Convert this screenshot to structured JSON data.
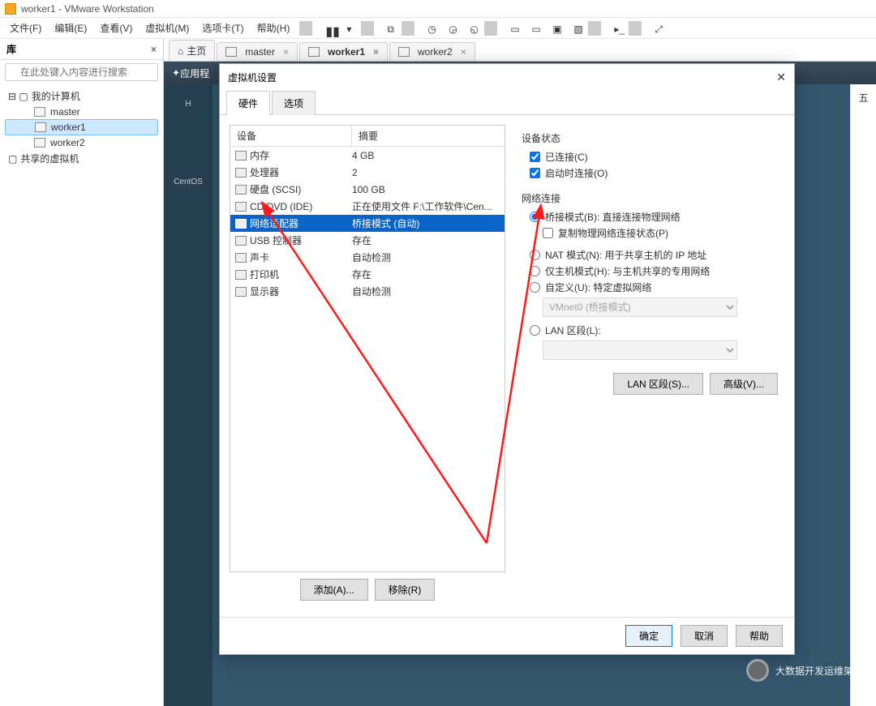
{
  "title": "worker1 - VMware Workstation",
  "menus": [
    "文件(F)",
    "编辑(E)",
    "查看(V)",
    "虚拟机(M)",
    "选项卡(T)",
    "帮助(H)"
  ],
  "library": {
    "title": "库",
    "search_placeholder": "在此处键入内容进行搜索",
    "root": "我的计算机",
    "items": [
      "master",
      "worker1",
      "worker2"
    ],
    "selected": "worker1",
    "shared": "共享的虚拟机"
  },
  "tabs": {
    "home": "主页",
    "items": [
      "master",
      "worker1",
      "worker2"
    ],
    "active": "worker1",
    "app_strip": "应用程",
    "right_label": "五"
  },
  "desktop_side_label": "CentOS",
  "dialog": {
    "title": "虚拟机设置",
    "tabs": [
      "硬件",
      "选项"
    ],
    "headers": {
      "device": "设备",
      "summary": "摘要"
    },
    "devices": [
      {
        "name": "内存",
        "summary": "4 GB"
      },
      {
        "name": "处理器",
        "summary": "2"
      },
      {
        "name": "硬盘 (SCSI)",
        "summary": "100 GB"
      },
      {
        "name": "CD/DVD (IDE)",
        "summary": "正在使用文件 F:\\工作软件\\Cen..."
      },
      {
        "name": "网络适配器",
        "summary": "桥接模式 (自动)"
      },
      {
        "name": "USB 控制器",
        "summary": "存在"
      },
      {
        "name": "声卡",
        "summary": "自动检测"
      },
      {
        "name": "打印机",
        "summary": "存在"
      },
      {
        "name": "显示器",
        "summary": "自动检测"
      }
    ],
    "selected_device": "网络适配器",
    "buttons": {
      "add": "添加(A)...",
      "remove": "移除(R)"
    },
    "status": {
      "title": "设备状态",
      "connected": "已连接(C)",
      "connect_at_power_on": "启动时连接(O)"
    },
    "net": {
      "title": "网络连接",
      "bridged": "桥接模式(B): 直接连接物理网络",
      "replicate": "复制物理网络连接状态(P)",
      "nat": "NAT 模式(N): 用于共享主机的 IP 地址",
      "hostonly": "仅主机模式(H): 与主机共享的专用网络",
      "custom": "自定义(U): 特定虚拟网络",
      "custom_combo": "VMnet0 (桥接模式)",
      "lan": "LAN 区段(L):",
      "lan_btn": "LAN 区段(S)...",
      "adv_btn": "高级(V)..."
    },
    "footer": {
      "ok": "确定",
      "cancel": "取消",
      "help": "帮助"
    }
  },
  "watermark": "大数据开发运维架构"
}
